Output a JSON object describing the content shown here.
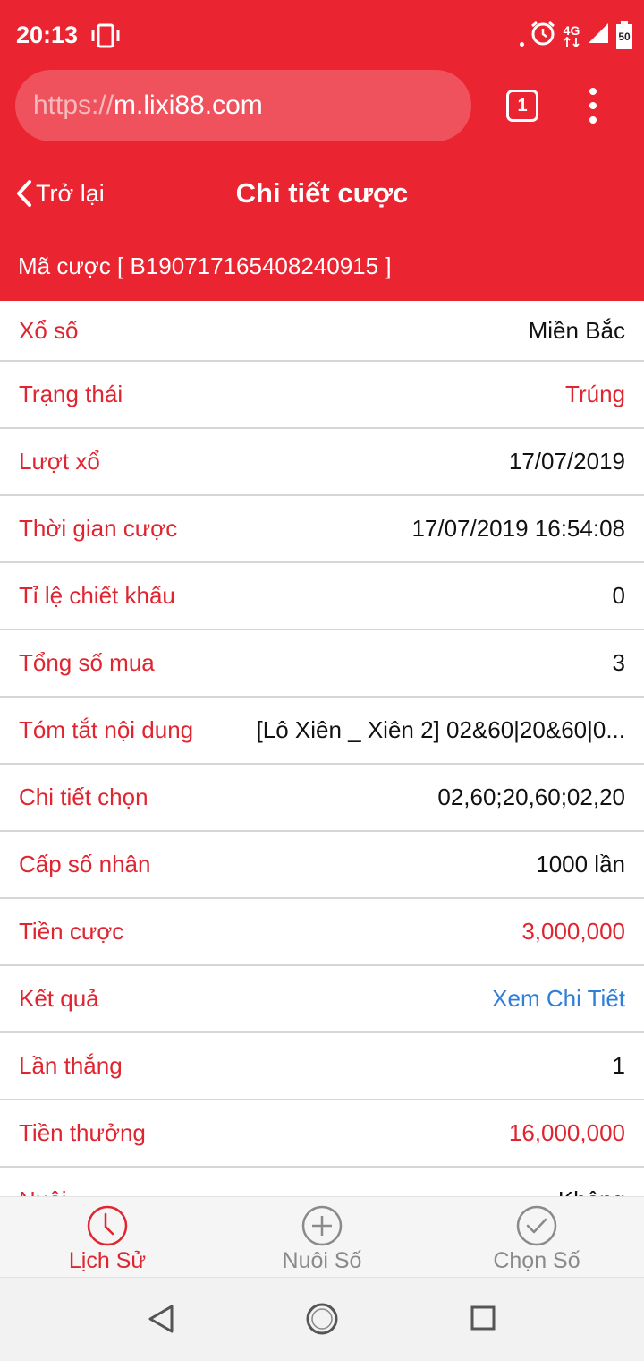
{
  "status_bar": {
    "time": "20:13",
    "network": "4G",
    "battery": "50"
  },
  "browser": {
    "url_scheme": "https://",
    "url_host": "m.lixi88.com",
    "tab_count": "1"
  },
  "header": {
    "back_label": "Trở lại",
    "title": "Chi tiết cược",
    "bet_code": "Mã cược [ B190717165408240915 ]"
  },
  "details": [
    {
      "label": "Xổ số",
      "value": "Miền Bắc",
      "value_color": "default"
    },
    {
      "label": "Trạng thái",
      "value": "Trúng",
      "value_color": "red"
    },
    {
      "label": "Lượt xổ",
      "value": "17/07/2019",
      "value_color": "default"
    },
    {
      "label": "Thời gian cược",
      "value": "17/07/2019 16:54:08",
      "value_color": "default"
    },
    {
      "label": "Tỉ lệ chiết khấu",
      "value": "0",
      "value_color": "default"
    },
    {
      "label": "Tổng số mua",
      "value": "3",
      "value_color": "default"
    },
    {
      "label": "Tóm tắt nội dung",
      "value": "[Lô Xiên _ Xiên 2] 02&60|20&60|0...",
      "value_color": "default"
    },
    {
      "label": "Chi tiết chọn",
      "value": "02,60;20,60;02,20",
      "value_color": "default"
    },
    {
      "label": "Cấp số nhân",
      "value": "1000 lần",
      "value_color": "default"
    },
    {
      "label": "Tiền cược",
      "value": "3,000,000",
      "value_color": "red"
    },
    {
      "label": "Kết quả",
      "value": "Xem Chi Tiết",
      "value_color": "blue"
    },
    {
      "label": "Lần thắng",
      "value": "1",
      "value_color": "default"
    },
    {
      "label": "Tiền thưởng",
      "value": "16,000,000",
      "value_color": "red"
    },
    {
      "label": "Nuôi",
      "value": "Không",
      "value_color": "default"
    }
  ],
  "bottom_nav": {
    "history": "Lịch Sử",
    "nurture": "Nuôi Số",
    "choose": "Chọn Số"
  },
  "colors": {
    "brand_red": "#ea2430",
    "label_red": "#e02530",
    "link_blue": "#2f7fd8"
  }
}
